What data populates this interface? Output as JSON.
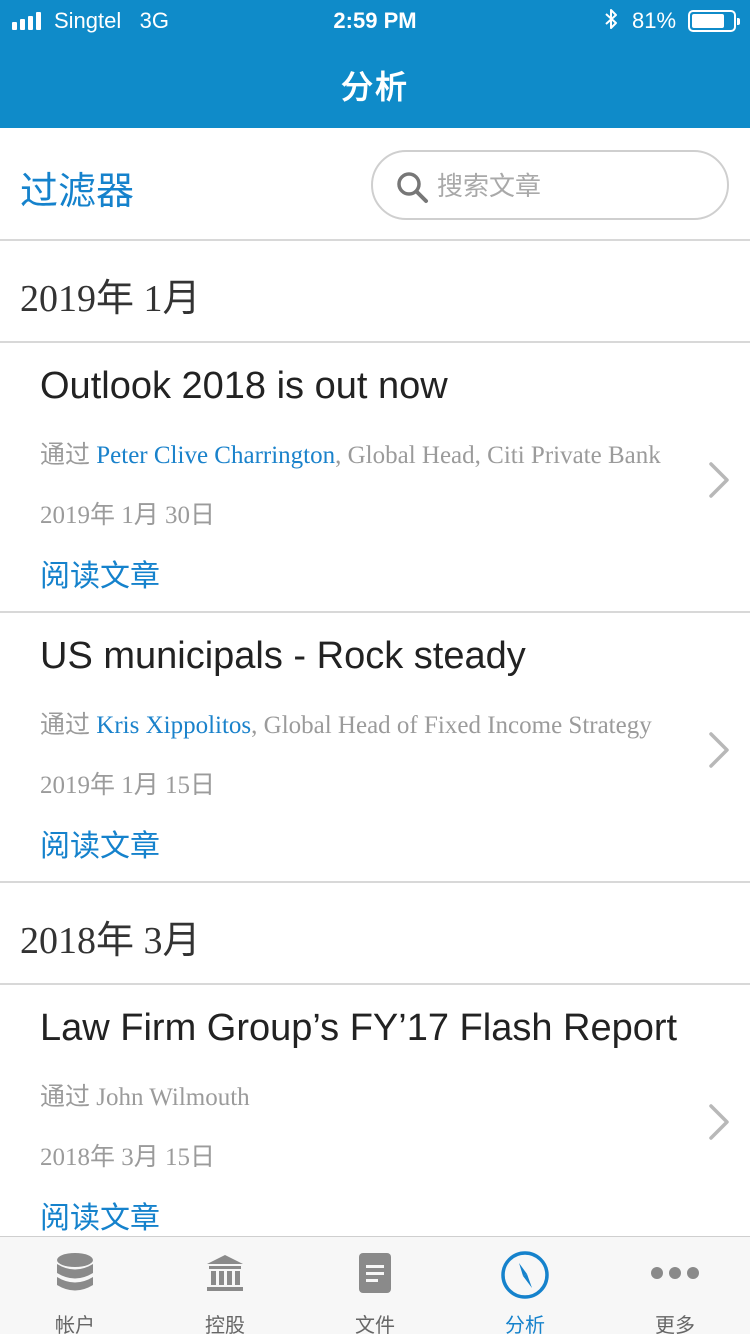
{
  "status_bar": {
    "carrier": "Singtel",
    "network": "3G",
    "time": "2:59 PM",
    "battery": "81%",
    "battery_level": 0.81,
    "icons": [
      "signal-bars-icon",
      "bluetooth-icon",
      "battery-icon"
    ]
  },
  "header": {
    "title": "分析"
  },
  "filter": {
    "label": "过滤器"
  },
  "search": {
    "placeholder": "搜索文章",
    "value": "",
    "icon": "search-icon"
  },
  "groups": [
    {
      "month": "2019年 1月"
    },
    {
      "month": "2018年 3月"
    }
  ],
  "articles": [
    {
      "title": "Outlook 2018 is out now",
      "by_prefix": "通过 ",
      "author": "Peter Clive Charrington",
      "role": ", Global Head, Citi Private Bank",
      "date": "2019年 1月 30日",
      "read_label": "阅读文章"
    },
    {
      "title": "US municipals - Rock steady",
      "by_prefix": "通过 ",
      "author": "Kris Xippolitos",
      "role": ", Global Head of Fixed Income Strategy",
      "date": "2019年 1月 15日",
      "read_label": "阅读文章"
    },
    {
      "title": "Law Firm Group’s FY’17 Flash Report",
      "by_prefix": "通过 ",
      "author": "",
      "role": "John Wilmouth",
      "date": "2018年 3月 15日",
      "read_label": "阅读文章"
    }
  ],
  "tabbar": {
    "active_index": 3,
    "accent": "#1582cc",
    "tabs": [
      {
        "label": "帐户",
        "icon": "database-icon"
      },
      {
        "label": "控股",
        "icon": "bank-icon"
      },
      {
        "label": "文件",
        "icon": "document-icon"
      },
      {
        "label": "分析",
        "icon": "compass-icon"
      },
      {
        "label": "更多",
        "icon": "more-dots-icon"
      }
    ]
  },
  "colors": {
    "header_bg": "#0f8bc9",
    "accent": "#1582cc",
    "muted": "#9b9b9b"
  }
}
